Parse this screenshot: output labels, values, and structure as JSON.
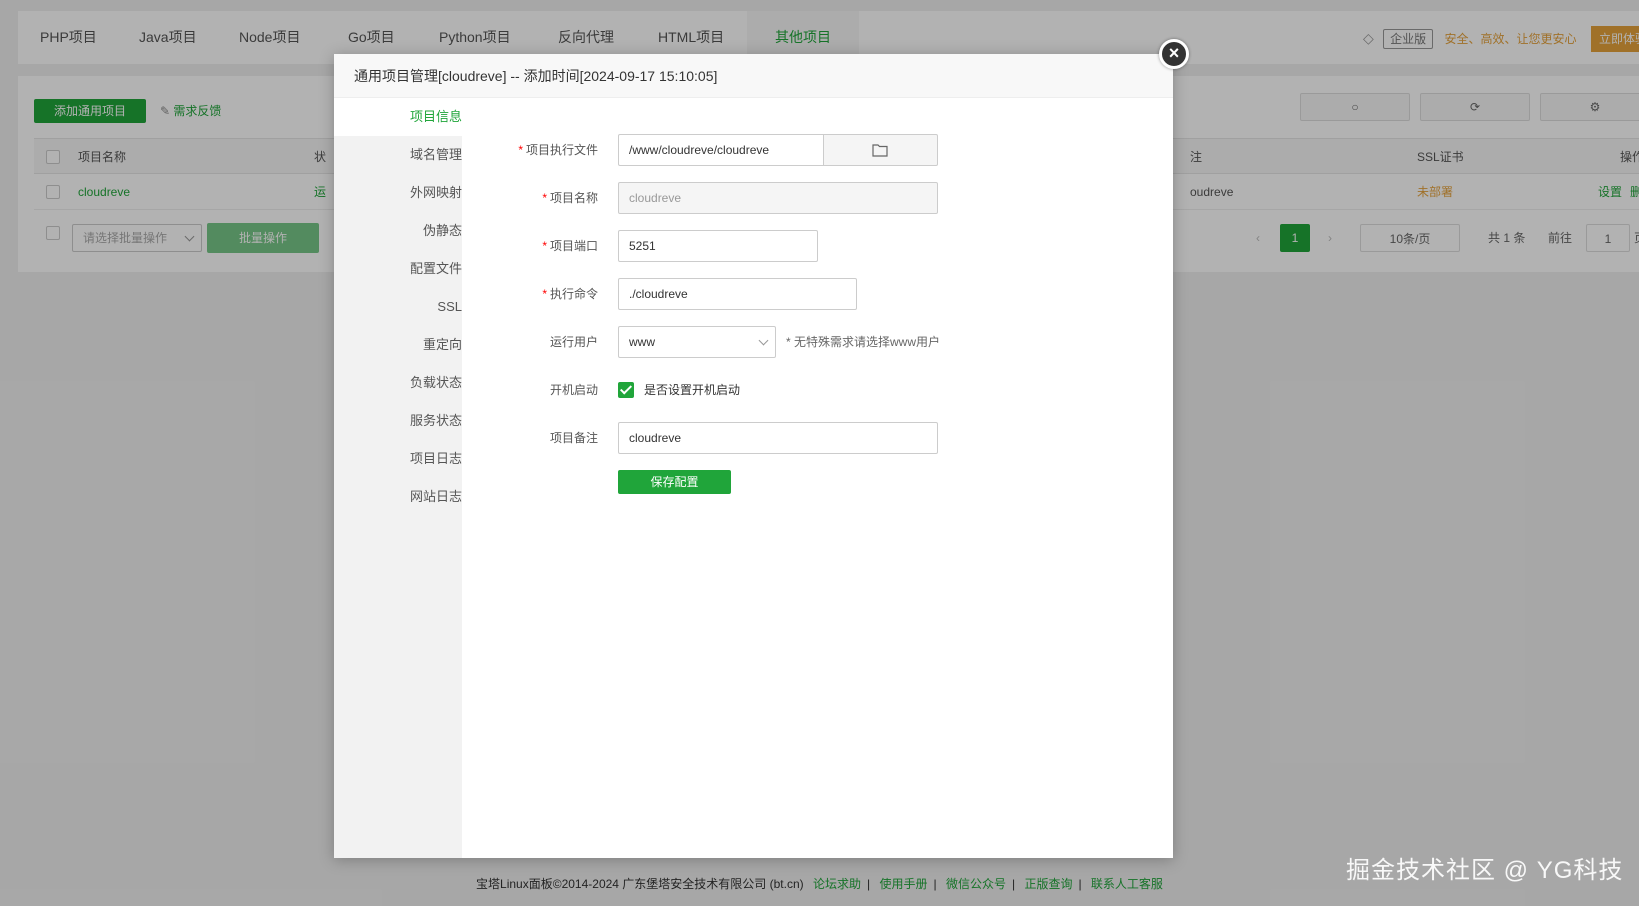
{
  "top_tabs": [
    "PHP项目",
    "Java项目",
    "Node项目",
    "Go项目",
    "Python项目",
    "反向代理",
    "HTML项目",
    "其他项目"
  ],
  "promo": {
    "badge": "企业版",
    "text": "安全、高效、让您更安心",
    "try_label": "立即体验"
  },
  "toolbar": {
    "add_label": "添加通用项目",
    "feedback_label": "需求反馈"
  },
  "table": {
    "headers": {
      "name": "项目名称",
      "status_partial": "状",
      "remark_partial": "注",
      "ssl": "SSL证书",
      "ops_partial": "操作"
    },
    "row": {
      "name": "cloudreve",
      "status_partial": "运",
      "remark_partial": "oudreve",
      "ssl": "未部署",
      "set": "设置",
      "del": "删除"
    }
  },
  "batch": {
    "placeholder": "请选择批量操作",
    "button": "批量操作"
  },
  "pager": {
    "page": "1",
    "per_page": "10条/页",
    "total": "共 1 条",
    "goto": "前往",
    "goto_value": "1",
    "page_unit": "页"
  },
  "modal": {
    "title": "通用项目管理[cloudreve] -- 添加时间[2024-09-17 15:10:05]",
    "close": "×",
    "nav": [
      "项目信息",
      "域名管理",
      "外网映射",
      "伪静态",
      "配置文件",
      "SSL",
      "重定向",
      "负载状态",
      "服务状态",
      "项目日志",
      "网站日志"
    ],
    "form": {
      "exec_file_label": "项目执行文件",
      "exec_file_value": "/www/cloudreve/cloudreve",
      "name_label": "项目名称",
      "name_value": "cloudreve",
      "port_label": "项目端口",
      "port_value": "5251",
      "cmd_label": "执行命令",
      "cmd_value": "./cloudreve",
      "user_label": "运行用户",
      "user_value": "www",
      "user_hint": "* 无特殊需求请选择www用户",
      "autostart_label": "开机启动",
      "autostart_text": "是否设置开机启动",
      "autostart_checked": true,
      "remark_label": "项目备注",
      "remark_value": "cloudreve",
      "save_label": "保存配置",
      "required_mark": "*"
    }
  },
  "footer": {
    "copyright": "宝塔Linux面板©2014-2024 广东堡塔安全技术有限公司 (bt.cn)",
    "links": [
      "论坛求助",
      "使用手册",
      "微信公众号",
      "正版查询",
      "联系人工客服"
    ]
  },
  "watermark": "掘金技术社区 @ YG科技",
  "colors": {
    "accent": "#20a53a",
    "warning": "#e6a23c",
    "required": "#ff0000"
  }
}
